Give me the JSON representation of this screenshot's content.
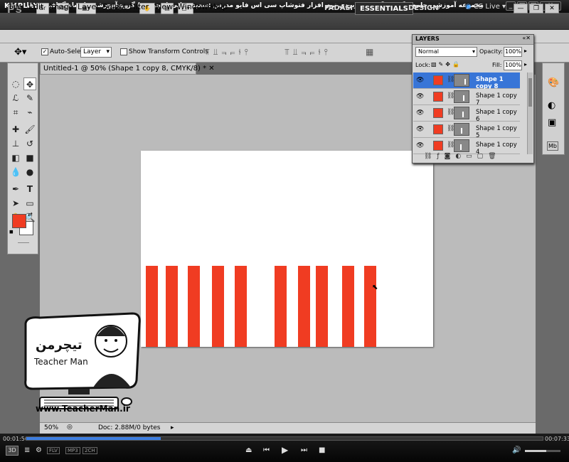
{
  "km": {
    "logo": "KMPLAYER",
    "caption": "مجموعه آموزشی جامع ، گام به گام و کاربردی نرم افزار فتوشاپ سی اس فایو   مدرس :سعید فدایی (تیچرمن ) گروه آموزشی پادشاه گرافیست ها",
    "time_current": "00:01:56",
    "time_total": "00:07:33",
    "badges": [
      "FLV",
      "MP3",
      "2CH"
    ],
    "progress": 0.26,
    "volume": 0.6
  },
  "ps": {
    "logo": "Ps",
    "app_icons": [
      "Br",
      "Mb"
    ],
    "zoom": "50%",
    "workspaces": [
      "FADAEI",
      "ESSENTIALS",
      "DESIGN"
    ],
    "active_workspace": "ESSENTIALS",
    "cs_live": "CS Live",
    "menus": [
      "File",
      "Edit",
      "Image",
      "Layer",
      "Select",
      "Filter",
      "View",
      "Window",
      "Help"
    ]
  },
  "options": {
    "auto_select_label": "Auto-Select:",
    "auto_select_value": "Layer",
    "transform_label": "Show Transform Controls"
  },
  "document": {
    "tab_title": "Untitled-1 @ 50% (Shape 1 copy 8, CMYK/8) *",
    "zoom": "50%",
    "doc_info": "Doc: 2.88M/0 bytes"
  },
  "colors": {
    "foreground": "#f03c22",
    "background": "#ffffff",
    "bar": "#f03c22",
    "selection": "#3875d7"
  },
  "layers": {
    "title": "LAYERS",
    "blend_mode": "Normal",
    "opacity_label": "Opacity:",
    "opacity": "100%",
    "lock_label": "Lock:",
    "fill_label": "Fill:",
    "fill": "100%",
    "items": [
      {
        "name": "Shape 1 copy 8",
        "selected": true
      },
      {
        "name": "Shape 1 copy 7",
        "selected": false
      },
      {
        "name": "Shape 1 copy 6",
        "selected": false
      },
      {
        "name": "Shape 1 copy 5",
        "selected": false
      },
      {
        "name": "Shape 1 copy 4",
        "selected": false
      }
    ]
  },
  "watermark": {
    "name_fa": "تیچرمن",
    "name_en": "Teacher Man",
    "url": "www.TeacherMan.ir"
  }
}
